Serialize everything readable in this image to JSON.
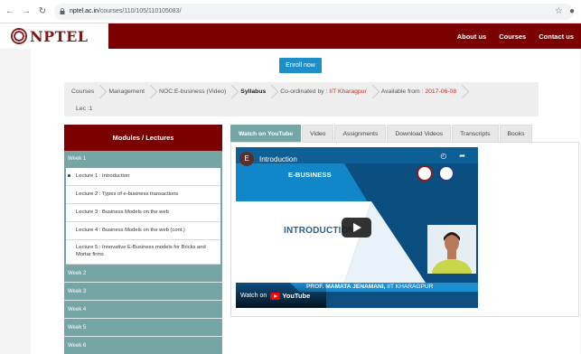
{
  "browser": {
    "url_host": "nptel.ac.in",
    "url_path": "/courses/110/105/110105083/"
  },
  "header": {
    "brand": "NPTEL",
    "nav": [
      "About us",
      "Courses",
      "Contact us"
    ]
  },
  "enroll_label": "Enroll now",
  "breadcrumb": {
    "items": [
      "Courses",
      "Management",
      "NOC:E-business (Video)",
      "Syllabus"
    ],
    "coordinated_label": "Co-ordinated by : ",
    "coordinated_value": "IIT Kharagpur",
    "available_label": "Available from : ",
    "available_value": "2017-06-08",
    "lec": "Lec :1"
  },
  "sidebar": {
    "title": "Modules / Lectures",
    "open_week": "Week 1",
    "lectures": [
      "Lecture 1 : Introduction",
      "Lecture 2 : Types of e-business transactions",
      "Lecture 3 : Business Models on the web",
      "Lecture 4 : Business Models on the web (cont.)",
      "Lecture 5 : Innovative E-Business models for Bricks and Mortar firms"
    ],
    "other_weeks": [
      "Week 2",
      "Week 3",
      "Week 4",
      "Week 5",
      "Week 6"
    ]
  },
  "tabs": [
    "Watch on YouTube",
    "Video",
    "Assignments",
    "Download Videos",
    "Transcripts",
    "Books"
  ],
  "video": {
    "channel_initial": "E",
    "title": "Introduction",
    "slide_heading": "E-BUSINESS",
    "slide_main": "INTRODUCTION",
    "presenter_name": "PROF. MAMATA JENAMANI,",
    "presenter_inst": "IIT KHARAGPUR",
    "watch_on": "Watch on",
    "youtube": "YouTube"
  }
}
